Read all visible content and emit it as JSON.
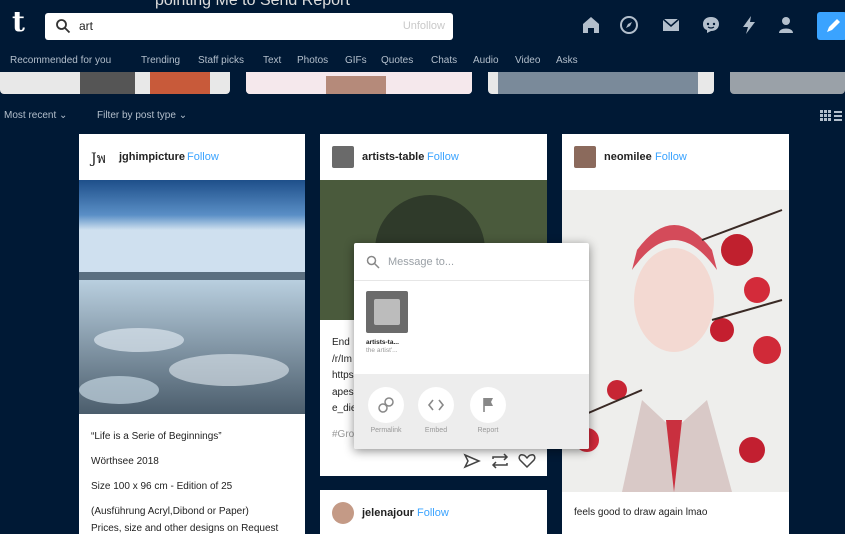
{
  "caption": "pointing Me to Send Report",
  "search": {
    "value": "art",
    "unfollow_label": "Unfollow"
  },
  "tabs": [
    "Recommended for you",
    "Trending",
    "Staff picks",
    "Text",
    "Photos",
    "GIFs",
    "Quotes",
    "Chats",
    "Audio",
    "Video",
    "Asks"
  ],
  "filters": {
    "sort_label": "Most recent",
    "filter_label": "Filter by post type"
  },
  "posts": [
    {
      "username": "jghimpicture",
      "avatar_text": "Jพ",
      "follow": "Follow",
      "lines": [
        "“Life is a Serie of Beginnings”",
        "Wörthsee 2018",
        "Size 100 x 96 cm - Edition of 25",
        "(Ausführung Acryl,Dibond or Paper)",
        "Prices, size and other designs on Request"
      ]
    },
    {
      "username": "artists-table",
      "follow": "Follow",
      "lines": [
        "End",
        "/r/Im",
        "https",
        "apes",
        "e_die",
        "#Gro"
      ]
    },
    {
      "username": "neomilee",
      "follow": "Follow",
      "caption": "feels good to draw again lmao"
    },
    {
      "username": "jelenajour",
      "follow": "Follow"
    }
  ],
  "share_popup": {
    "placeholder": "Message to...",
    "recipient_name": "artists-ta...",
    "recipient_sub": "the artist'...",
    "actions": [
      "Permalink",
      "Embed",
      "Report"
    ]
  }
}
